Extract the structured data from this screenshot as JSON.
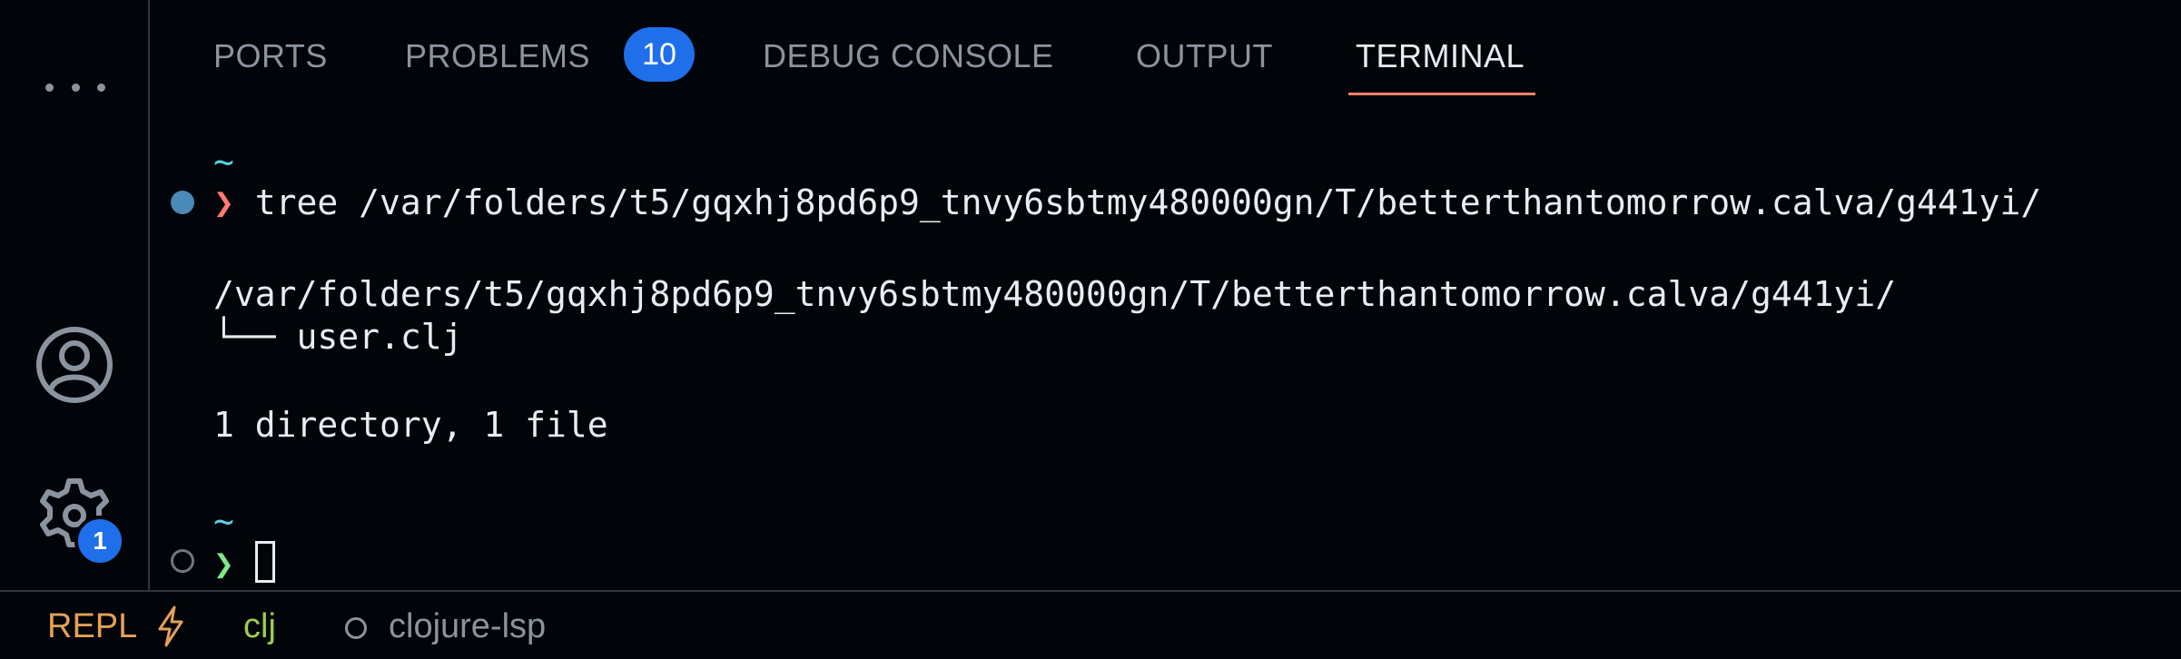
{
  "activity_bar": {
    "more_icon": "ellipsis-icon",
    "account_icon": "account-icon",
    "manage_icon": "gear-icon",
    "manage_badge": "1"
  },
  "panel": {
    "tabs": [
      {
        "label": "PORTS",
        "active": false
      },
      {
        "label": "PROBLEMS",
        "active": false,
        "badge": "10"
      },
      {
        "label": "DEBUG CONSOLE",
        "active": false
      },
      {
        "label": "OUTPUT",
        "active": false
      },
      {
        "label": "TERMINAL",
        "active": true
      }
    ]
  },
  "terminal": {
    "prompt_dir_1": "~",
    "prompt_symbol_1": "❯",
    "command": "tree /var/folders/t5/gqxhj8pd6p9_tnvy6sbtmy480000gn/T/betterthantomorrow.calva/g441yi/",
    "output": [
      "/var/folders/t5/gqxhj8pd6p9_tnvy6sbtmy480000gn/T/betterthantomorrow.calva/g441yi/",
      "└── user.clj",
      "1 directory, 1 file"
    ],
    "prompt_dir_2": "~",
    "prompt_symbol_2": "❯"
  },
  "status_bar": {
    "repl_label": "REPL",
    "repl_icon": "lightning-bolt-icon",
    "clj_label": "clj",
    "lsp_icon": "circle-outline-icon",
    "lsp_label": "clojure-lsp"
  },
  "colors": {
    "background": "#010409",
    "active_tab_underline": "#f78166",
    "badge": "#1f6feb",
    "tilde": "#56d4dd",
    "prompt_error": "#ff7b72",
    "prompt_ok": "#7ee787",
    "repl": "#e3a15a",
    "clj": "#9bcd4e"
  }
}
